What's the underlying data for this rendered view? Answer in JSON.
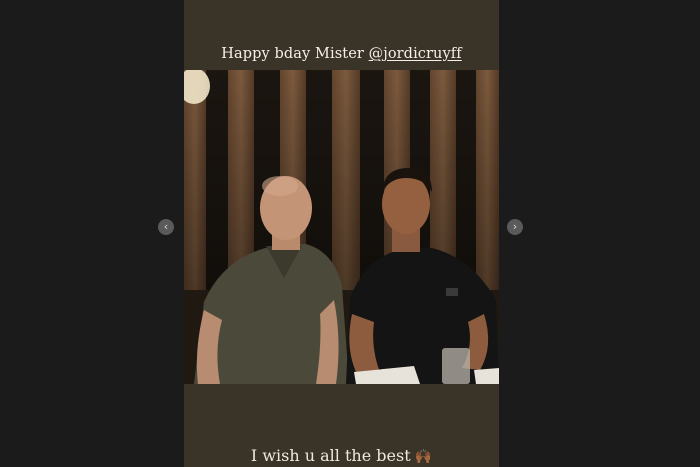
{
  "story": {
    "caption_top_prefix": "Happy bday Mister ",
    "caption_top_mention": "@jordicruyff",
    "caption_bottom": "I wish u all the best",
    "caption_bottom_emoji": "🙌🏾"
  },
  "nav": {
    "prev_glyph": "‹",
    "next_glyph": "›"
  },
  "colors": {
    "viewer_bg": "#1b1b1b",
    "story_bg": "#3a3327",
    "caption_text": "#f4f1ea"
  }
}
